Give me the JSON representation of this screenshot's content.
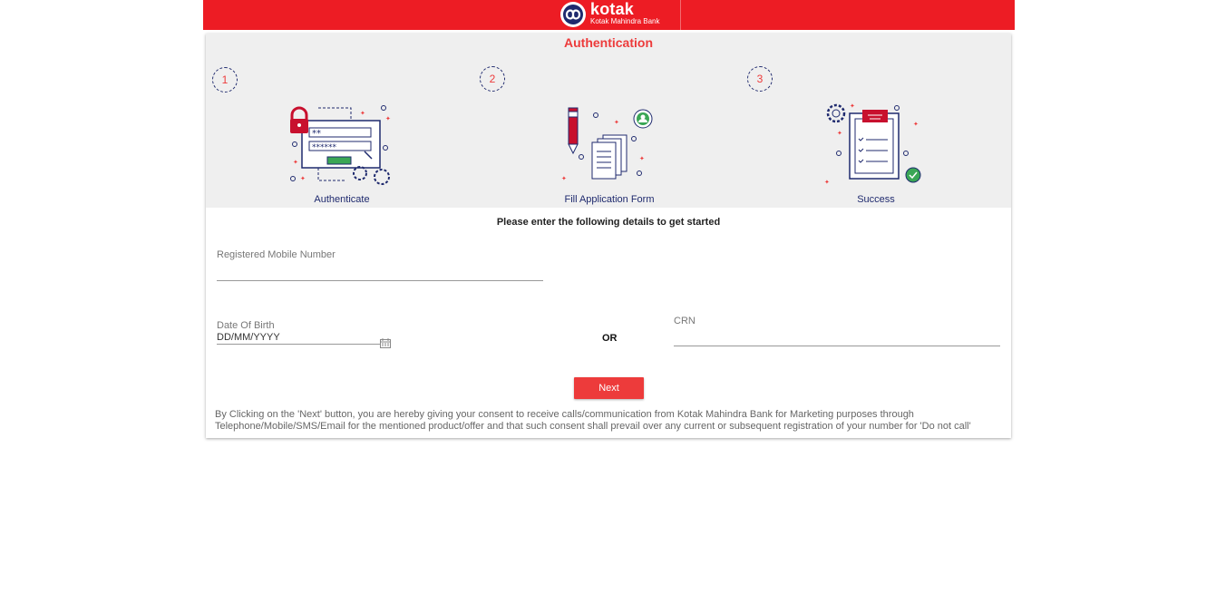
{
  "brand": {
    "name": "kotak",
    "tagline": "Kotak Mahindra Bank",
    "color": "#ed1c24",
    "accent": "#ed3b3b",
    "navy": "#1f2a6e",
    "logo_icon": "kotak-infinity-logo"
  },
  "page": {
    "title": "Authentication"
  },
  "steps": [
    {
      "number": "1",
      "label": "Authenticate",
      "icon": "authenticate-illustration"
    },
    {
      "number": "2",
      "label": "Fill Application Form",
      "icon": "form-illustration"
    },
    {
      "number": "3",
      "label": "Success",
      "icon": "success-illustration"
    }
  ],
  "form": {
    "intro": "Please enter the following details to get started",
    "mobile": {
      "label": "Registered Mobile Number",
      "value": ""
    },
    "dob": {
      "label": "Date Of Birth",
      "placeholder": "DD/MM/YYYY",
      "icon": "calendar-icon"
    },
    "or_text": "OR",
    "crn": {
      "label": "CRN",
      "value": ""
    },
    "next_label": "Next"
  },
  "consent": {
    "text": "By Clicking on the 'Next' button, you are hereby giving your consent to receive calls/communication from Kotak Mahindra Bank for Marketing purposes through Telephone/Mobile/SMS/Email for the mentioned product/offer and that such consent shall prevail over any current or subsequent registration of your number for 'Do not call'"
  }
}
